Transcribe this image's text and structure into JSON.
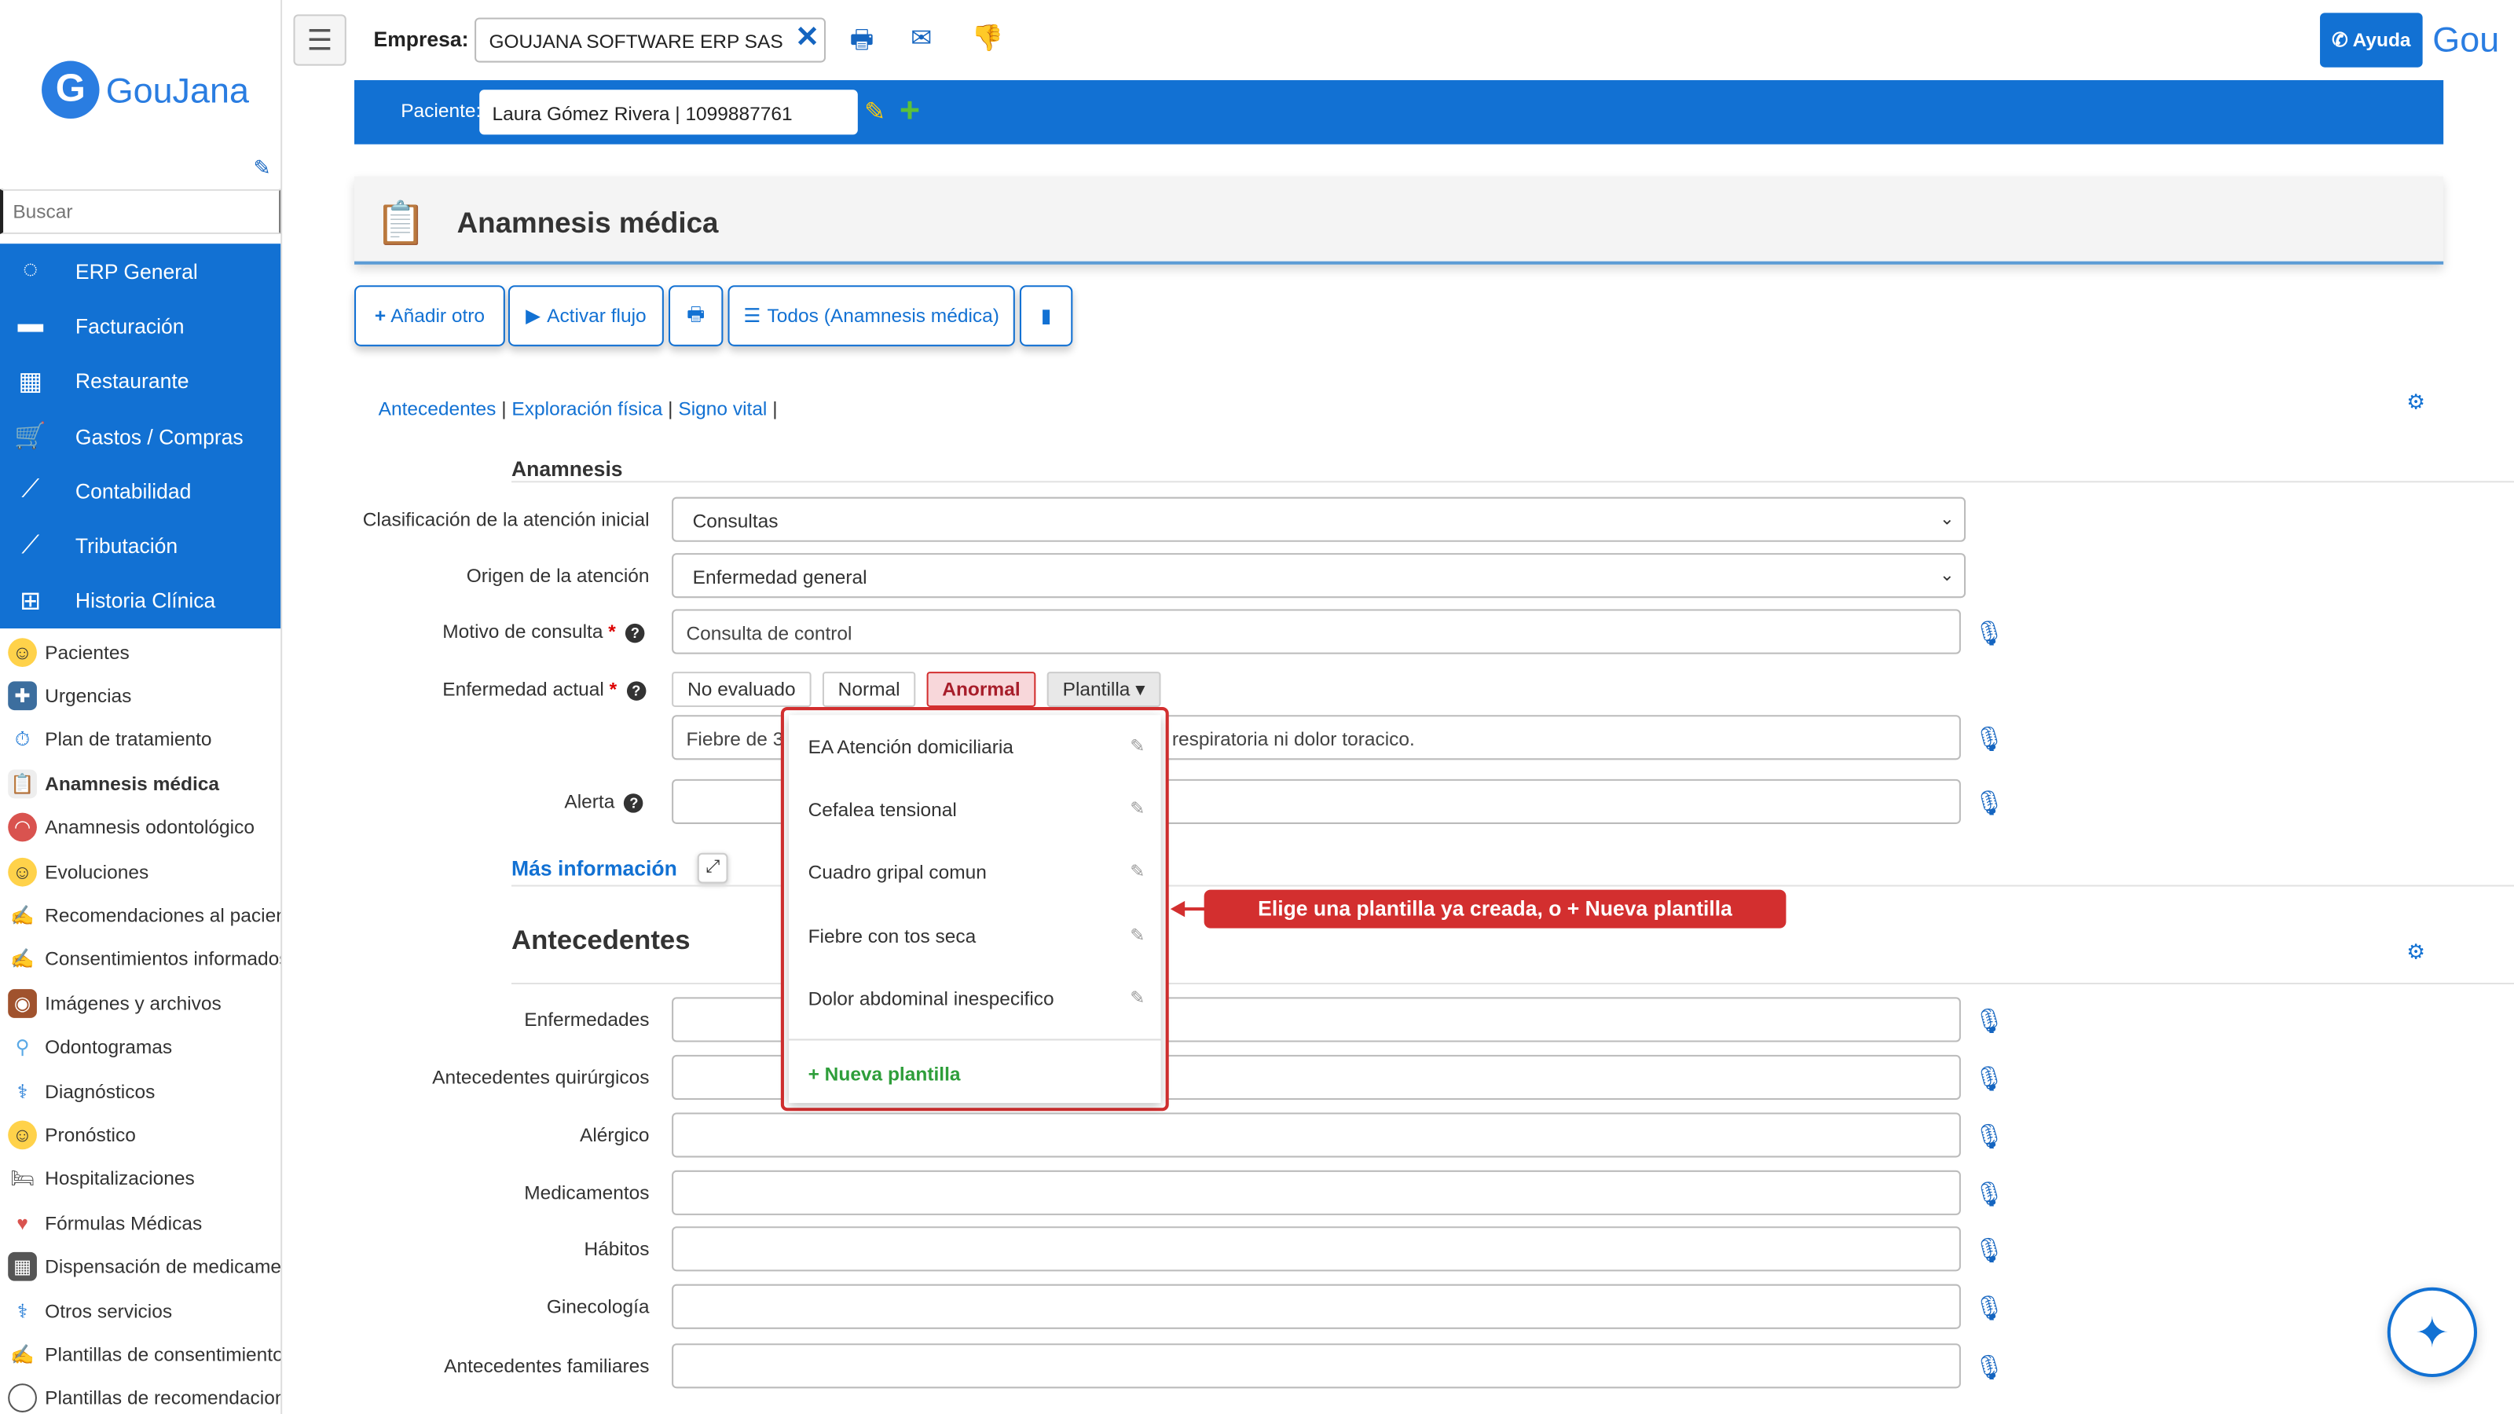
{
  "sidebar": {
    "logo_text": "GouJana",
    "search_placeholder": "Buscar",
    "modules": [
      {
        "label": "ERP General",
        "icon": "refresh-icon"
      },
      {
        "label": "Facturación",
        "icon": "card-icon"
      },
      {
        "label": "Restaurante",
        "icon": "calendar-icon"
      },
      {
        "label": "Gastos / Compras",
        "icon": "cart-icon"
      },
      {
        "label": "Contabilidad",
        "icon": "chart-icon"
      },
      {
        "label": "Tributación",
        "icon": "chart-icon"
      },
      {
        "label": "Historia Clínica",
        "icon": "plus-square-icon"
      }
    ],
    "items": [
      {
        "label": "Pacientes"
      },
      {
        "label": "Urgencias"
      },
      {
        "label": "Plan de tratamiento"
      },
      {
        "label": "Anamnesis médica"
      },
      {
        "label": "Anamnesis odontológico"
      },
      {
        "label": "Evoluciones"
      },
      {
        "label": "Recomendaciones al pacien"
      },
      {
        "label": "Consentimientos informados"
      },
      {
        "label": "Imágenes y archivos"
      },
      {
        "label": "Odontogramas"
      },
      {
        "label": "Diagnósticos"
      },
      {
        "label": "Pronóstico"
      },
      {
        "label": "Hospitalizaciones"
      },
      {
        "label": "Fórmulas Médicas"
      },
      {
        "label": "Dispensación de medicamer"
      },
      {
        "label": "Otros servicios"
      },
      {
        "label": "Plantillas de consentimiento"
      },
      {
        "label": "Plantillas de recomendacion"
      }
    ]
  },
  "topbar": {
    "empresa_label": "Empresa:",
    "empresa_value": "GOUJANA SOFTWARE ERP SAS",
    "help_label": "Ayuda",
    "user_text": "Gou"
  },
  "patient": {
    "label": "Paciente:",
    "value": "Laura Gómez Rivera | 1099887761"
  },
  "header": {
    "title": "Anamnesis médica"
  },
  "toolbar": {
    "add_label": "Añadir otro",
    "flow_label": "Activar flujo",
    "all_label": "Todos (Anamnesis médica)"
  },
  "links": {
    "antecedentes": "Antecedentes",
    "exploracion": "Exploración física",
    "signo": "Signo vital",
    "sep": "|"
  },
  "anamnesis": {
    "section_title": "Anamnesis",
    "clasificacion_label": "Clasificación de la atención inicial",
    "clasificacion_value": "Consultas",
    "origen_label": "Origen de la atención",
    "origen_value": "Enfermedad general",
    "motivo_label": "Motivo de consulta",
    "motivo_value": "Consulta de control",
    "enfermedad_label": "Enfermedad actual",
    "options": [
      "No evaluado",
      "Normal",
      "Anormal",
      "Plantilla ▾"
    ],
    "enfermedad_text_left": "Fiebre de 3",
    "enfermedad_text_right": "d respiratoria ni dolor toracico.",
    "alerta_label": "Alerta",
    "required_mark": "*",
    "mas_info": "Más información"
  },
  "templates": {
    "items": [
      "EA Atención domiciliaria",
      "Cefalea tensional",
      "Cuadro gripal comun",
      "Fiebre con tos seca",
      "Dolor abdominal inespecifico"
    ],
    "new_label": "+ Nueva plantilla",
    "callout": "Elige una plantilla ya creada, o + Nueva plantilla"
  },
  "antecedentes": {
    "section_title": "Antecedentes",
    "fields": [
      "Enfermedades",
      "Antecedentes quirúrgicos",
      "Alérgico",
      "Medicamentos",
      "Hábitos",
      "Ginecología",
      "Antecedentes familiares"
    ]
  },
  "colors": {
    "primary": "#1271d3",
    "danger": "#d32f2f",
    "success": "#2e9e3a"
  }
}
